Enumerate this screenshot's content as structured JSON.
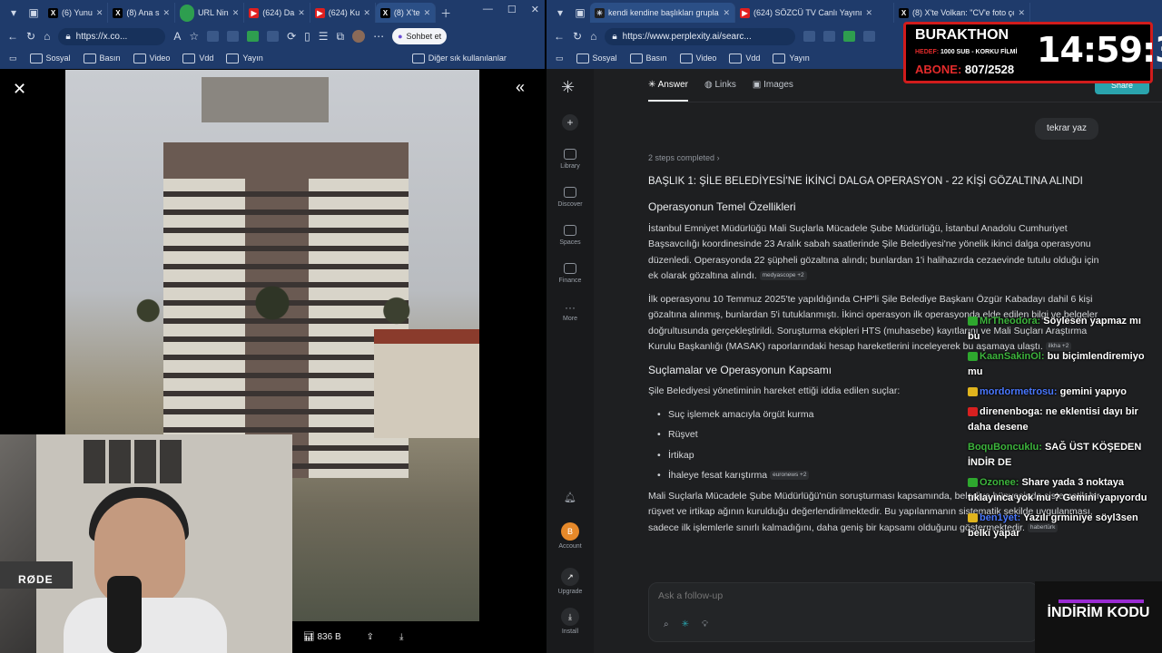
{
  "left_window": {
    "tabs": [
      {
        "favicon": "x",
        "title": "(6) Yunu",
        "icon": "x-logo-icon"
      },
      {
        "favicon": "x",
        "title": "(8) Ana s",
        "icon": "x-logo-icon"
      },
      {
        "favicon": "url",
        "title": "URL Nin",
        "icon": "url-shortener-icon"
      },
      {
        "favicon": "yt",
        "title": "(624) Da",
        "icon": "youtube-icon"
      },
      {
        "favicon": "yt",
        "title": "(624) Ku",
        "icon": "youtube-icon"
      },
      {
        "favicon": "x",
        "title": "(8) X'te",
        "icon": "x-logo-icon"
      }
    ],
    "url": "https://x.co...",
    "bookmarks": [
      "Sosyal",
      "Basın",
      "Video",
      "Vdd",
      "Yayın"
    ],
    "bookmarks_other": "Diğer sık kullanılanlar",
    "copilot_label": "Sohbet et",
    "media": {
      "views": "836 B"
    }
  },
  "right_window": {
    "tabs": [
      {
        "favicon": "pp",
        "title": "kendi kendine başlıkları gruplandır",
        "icon": "perplexity-icon"
      },
      {
        "favicon": "yt",
        "title": "(624) SÖZCÜ TV Canlı Yayını",
        "icon": "youtube-icon"
      },
      {
        "favicon": "x",
        "title": "(8) X'te Volkan: \"CV'e foto çekerke",
        "icon": "x-logo-icon"
      }
    ],
    "url": "https://www.perplexity.ai/searc...",
    "bookmarks": [
      "Sosyal",
      "Basın",
      "Video",
      "Vdd",
      "Yayın"
    ]
  },
  "perplexity": {
    "rail": [
      {
        "label": "Library",
        "icon": "library-icon"
      },
      {
        "label": "Discover",
        "icon": "discover-icon"
      },
      {
        "label": "Spaces",
        "icon": "spaces-icon"
      },
      {
        "label": "Finance",
        "icon": "finance-icon"
      },
      {
        "label": "More",
        "icon": "more-icon"
      }
    ],
    "account_initial": "B",
    "account_label": "Account",
    "upgrade_label": "Upgrade",
    "install_label": "Install",
    "tabs": [
      "Answer",
      "Links",
      "Images"
    ],
    "share_label": "Share",
    "query": "tekrar yaz",
    "steps": "2 steps completed",
    "heading": "BAŞLIK 1: ŞİLE BELEDİYESİ'NE İKİNCİ DALGA OPERASYON - 22 KİŞİ GÖZALTINA ALINDI",
    "section1_title": "Operasyonun Temel Özellikleri",
    "para1": "İstanbul Emniyet Müdürlüğü Mali Suçlarla Mücadele Şube Müdürlüğü, İstanbul Anadolu Cumhuriyet Başsavcılığı koordinesinde 23 Aralık sabah saatlerinde Şile Belediyesi'ne yönelik ikinci dalga operasyonu düzenledi. Operasyonda 22 şüpheli gözaltına alındı; bunlardan 1'i halihazırda cezaevinde tutulu olduğu için ek olarak gözaltına alındı.",
    "cite1": "medyascope +2",
    "para2": "İlk operasyonu 10 Temmuz 2025'te yapıldığında CHP'li Şile Belediye Başkanı Özgür Kabadayı dahil 6 kişi gözaltına alınmış, bunlardan 5'i tutuklanmıştı. İkinci operasyon ilk operasyonda elde edilen bilgi ve belgeler doğrultusunda gerçekleştirildi. Soruşturma ekipleri HTS (muhasebe) kayıtlarını ve Mali Suçları Araştırma Kurulu Başkanlığı (MASAK) raporlarındaki hesap hareketlerini inceleyerek bu aşamaya ulaştı.",
    "cite2": "ilkha +2",
    "section2_title": "Suçlamalar ve Operasyonun Kapsamı",
    "para3": "Şile Belediyesi yönetiminin hareket ettiği iddia edilen suçlar:",
    "bullets": [
      "Suç işlemek amacıyla örgüt kurma",
      "Rüşvet",
      "İrtikap",
      "İhaleye fesat karıştırma"
    ],
    "cite3": "euronews +2",
    "para4": "Mali Suçlarla Mücadele Şube Müdürlüğü'nün soruşturması kapsamında, belediye bünyesinde sistematik bir rüşvet ve irtikap ağının kurulduğu değerlendirilmektedir. Bu yapılanmanın sistematik şekilde uygulanması, sadece ilk işlemlerle sınırlı kalmadığını, daha geniş bir kapsamı olduğunu göstermektedir.",
    "cite4": "habertürk",
    "followup_placeholder": "Ask a follow-up"
  },
  "stream": {
    "name": "BURAKTHON",
    "goal_label": "HEDEF:",
    "goal_text": "1000 SUB - KORKU FİLMİ",
    "subs_label": "ABONE:",
    "subs_value": "807/2528",
    "clock": "14:59:39",
    "promo": "İNDİRİM KODU",
    "mic_brand": "RØDE",
    "chat": [
      {
        "user": "MrTheodora:",
        "text": "Söylesen yapmaz mı bu",
        "color": "#3db53d",
        "badge": "#2ea82e"
      },
      {
        "user": "KaanSakinOl:",
        "text": "bu biçimlendiremiyo mu",
        "color": "#3db53d",
        "badge": "#2ea82e"
      },
      {
        "user": "mordormetrosu:",
        "text": "gemini yapıyo",
        "color": "#4a78ff",
        "badge": "#e0b41d"
      },
      {
        "user": "direnenboga:",
        "text": "ne eklentisi dayı bir daha desene",
        "color": "#ffffff",
        "badge": "#d82020"
      },
      {
        "user": "BoquBoncuklu:",
        "text": "SAĞ ÜST KÖŞEDEN İNDİR DE",
        "color": "#3db53d",
        "badge": ""
      },
      {
        "user": "Ozonee:",
        "text": "Share yada 3 noktaya tıklayınca yok mu ? Gemini yapıyordu",
        "color": "#3db53d",
        "badge": "#2ea82e"
      },
      {
        "user": "ben1yet:",
        "text": "Yazılı grminiye söyl3sen belki yapar",
        "color": "#4a78ff",
        "badge": "#e0b41d"
      }
    ]
  }
}
